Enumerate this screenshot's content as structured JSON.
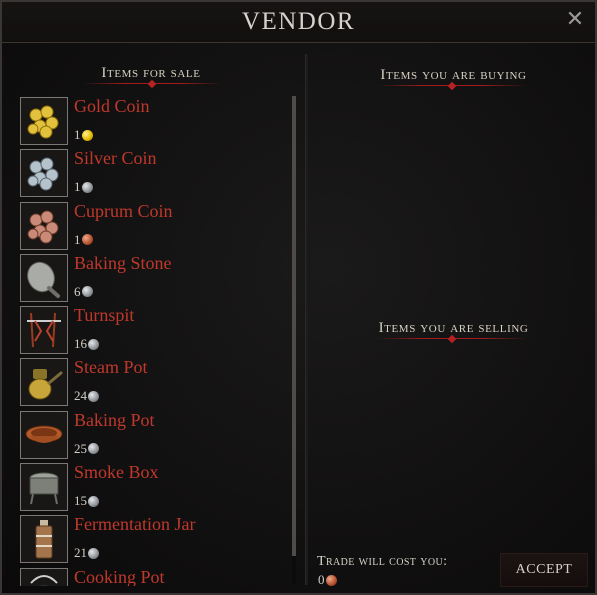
{
  "window": {
    "title": "VENDOR"
  },
  "sections": {
    "for_sale": "Items for sale",
    "buying": "Items you are buying",
    "selling": "Items you are selling"
  },
  "items": [
    {
      "name": "Gold Coin",
      "price": "1",
      "currency": "gold",
      "icon": "gold-coins-icon"
    },
    {
      "name": "Silver Coin",
      "price": "1",
      "currency": "silver",
      "icon": "silver-coins-icon"
    },
    {
      "name": "Cuprum Coin",
      "price": "1",
      "currency": "cuprum",
      "icon": "cuprum-coins-icon"
    },
    {
      "name": "Baking Stone",
      "price": "6",
      "currency": "silver",
      "icon": "baking-stone-icon"
    },
    {
      "name": "Turnspit",
      "price": "16",
      "currency": "silver",
      "icon": "turnspit-icon"
    },
    {
      "name": "Steam Pot",
      "price": "24",
      "currency": "silver",
      "icon": "steam-pot-icon"
    },
    {
      "name": "Baking Pot",
      "price": "25",
      "currency": "silver",
      "icon": "baking-pot-icon"
    },
    {
      "name": "Smoke Box",
      "price": "15",
      "currency": "silver",
      "icon": "smoke-box-icon"
    },
    {
      "name": "Fermentation Jar",
      "price": "21",
      "currency": "silver",
      "icon": "fermentation-jar-icon"
    },
    {
      "name": "Cooking Pot",
      "price": "",
      "currency": "silver",
      "icon": "cooking-pot-icon"
    }
  ],
  "trade": {
    "cost_label": "Trade will cost you:",
    "cost_value": "0",
    "cost_currency": "cuprum",
    "accept_label": "ACCEPT"
  },
  "colors": {
    "item_name": "#c0382c",
    "ornament": "#a21c1c"
  }
}
